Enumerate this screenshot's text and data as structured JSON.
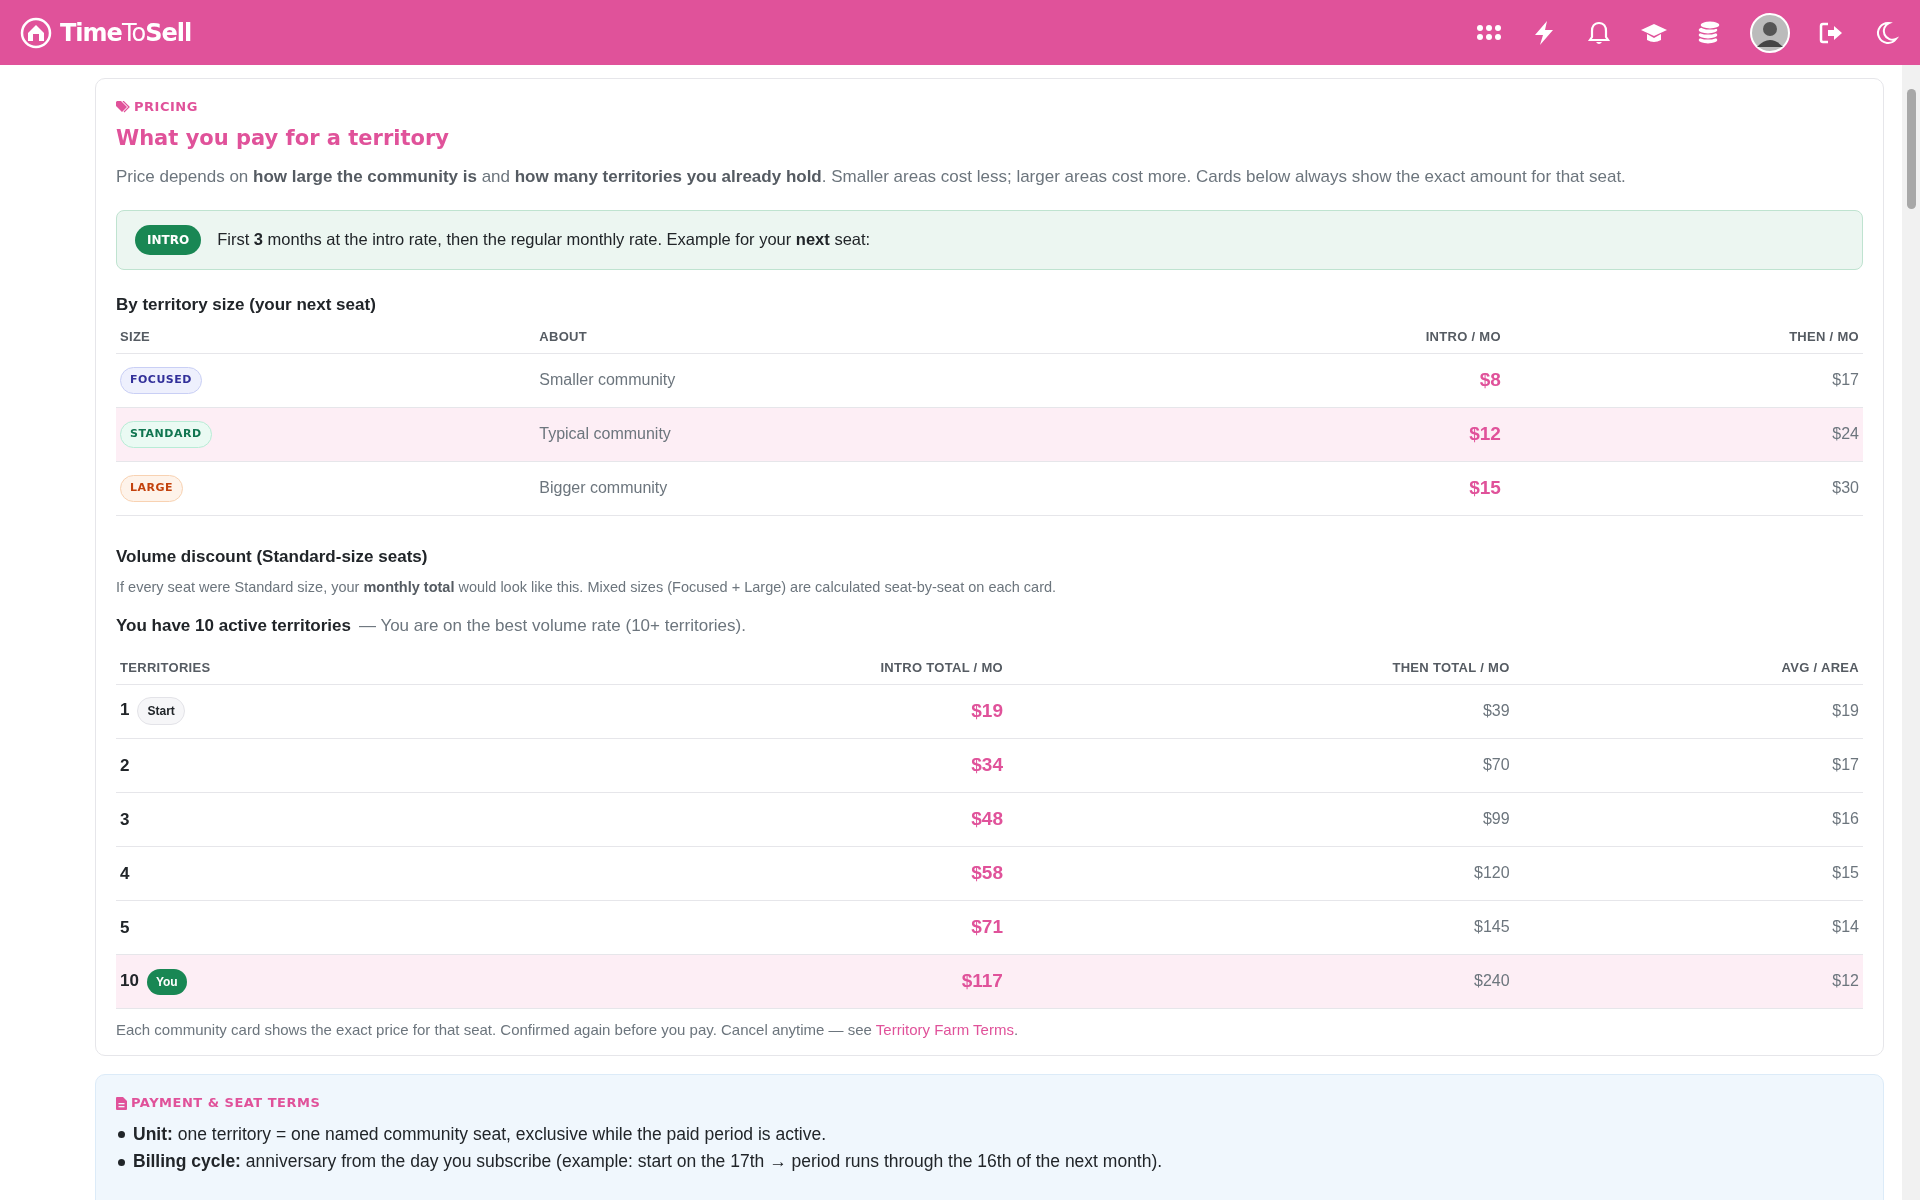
{
  "navbar": {
    "brand_prefix": "Time",
    "brand_middle": "To",
    "brand_suffix": "Sell"
  },
  "pricing": {
    "eyebrow": "PRICING",
    "title": "What you pay for a territory",
    "intro": "Price depends on **how large the community is** and **how many territories you already hold**. Smaller areas cost less; larger areas cost more. Cards below always show the exact amount for that seat.",
    "alert": {
      "badge": "INTRO",
      "text": "First **3** months at the intro rate, then the regular monthly rate. Example for your **next** seat:"
    },
    "size_table": {
      "title": "By territory size (your next seat)",
      "columns": [
        "SIZE",
        "ABOUT",
        "INTRO / MO",
        "THEN / MO"
      ],
      "rows": [
        {
          "size": "FOCUSED",
          "kind": "focused",
          "about": "Smaller community",
          "intro": "$8",
          "then": "$17",
          "highlighted": false
        },
        {
          "size": "STANDARD",
          "kind": "standard",
          "about": "Typical community",
          "intro": "$12",
          "then": "$24",
          "highlighted": true
        },
        {
          "size": "LARGE",
          "kind": "large",
          "about": "Bigger community",
          "intro": "$15",
          "then": "$30",
          "highlighted": false
        }
      ]
    },
    "volume": {
      "title": "Volume discount (Standard-size seats)",
      "note": "If every seat were Standard size, your **monthly total** would look like this. Mixed sizes (Focused + Large) are calculated seat-by-seat on each card.",
      "status_strong": "You have 10 active territories",
      "status_rest": "— You are on the best volume rate (10+ territories).",
      "columns": [
        "TERRITORIES",
        "INTRO TOTAL / MO",
        "THEN TOTAL / MO",
        "AVG / AREA"
      ],
      "rows": [
        {
          "count": "1",
          "tag": {
            "text": "Start",
            "kind": "start"
          },
          "intro": "$19",
          "then": "$39",
          "avg": "$19",
          "highlighted": false
        },
        {
          "count": "2",
          "intro": "$34",
          "then": "$70",
          "avg": "$17",
          "highlighted": false
        },
        {
          "count": "3",
          "intro": "$48",
          "then": "$99",
          "avg": "$16",
          "highlighted": false
        },
        {
          "count": "4",
          "intro": "$58",
          "then": "$120",
          "avg": "$15",
          "highlighted": false
        },
        {
          "count": "5",
          "intro": "$71",
          "then": "$145",
          "avg": "$14",
          "highlighted": false
        },
        {
          "count": "10",
          "tag": {
            "text": "You",
            "kind": "you"
          },
          "intro": "$117",
          "then": "$240",
          "avg": "$12",
          "highlighted": true
        }
      ]
    },
    "footer": "Each community card shows the exact price for that seat. Confirmed again before you pay. Cancel anytime — see",
    "footer_link": "Territory Farm Terms",
    "footer_end": "."
  },
  "terms": {
    "eyebrow": "PAYMENT & SEAT TERMS",
    "items": [
      {
        "label": "Unit:",
        "text": "one territory = one named community seat, exclusive while the paid period is active."
      },
      {
        "label": "Billing cycle:",
        "text": "anniversary from the day you subscribe (example: start on the 17th → period runs through the 16th of the next month)."
      }
    ]
  }
}
